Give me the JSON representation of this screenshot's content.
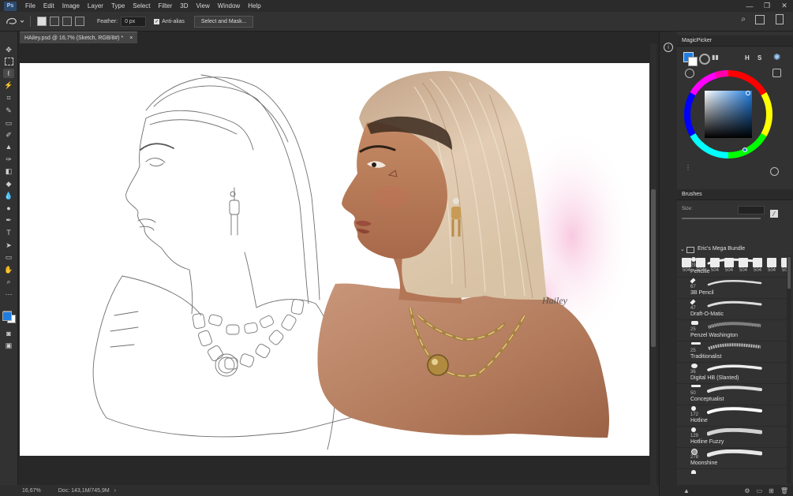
{
  "menu": [
    "File",
    "Edit",
    "Image",
    "Layer",
    "Type",
    "Select",
    "Filter",
    "3D",
    "View",
    "Window",
    "Help"
  ],
  "app_logo": "Ps",
  "options": {
    "feather_label": "Feather:",
    "feather_value": "0 px",
    "antialias_label": "Anti-alias",
    "select_mask": "Select and Mask..."
  },
  "document": {
    "tab": "HAiley.psd @ 16,7% (Sketch, RGB/8#) *",
    "close": "×"
  },
  "status": {
    "zoom": "16,67%",
    "doc": "Doc: 143,1M/745,9M"
  },
  "magic_picker": {
    "title": "MagicPicker",
    "h": "H",
    "s": "S",
    "fg_color": "#1f7de0",
    "bg_color": "#ffffff",
    "picked_color": "#5f9fe0"
  },
  "brushes_panel": {
    "title": "Brushes",
    "size_label": "Size:",
    "preset_sizes": [
      "504",
      "504",
      "504",
      "504",
      "504",
      "504",
      "504",
      "504"
    ],
    "folder": "Eric's Mega Bundle",
    "items": [
      {
        "size": "29",
        "name": "Pencille"
      },
      {
        "size": "67",
        "name": "3B Pencil"
      },
      {
        "size": "47",
        "name": "Draft-O-Matic"
      },
      {
        "size": "25",
        "name": "Penzel Washington"
      },
      {
        "size": "25",
        "name": "Traditionalist"
      },
      {
        "size": "36",
        "name": "Digital HB (Slanted)"
      },
      {
        "size": "50",
        "name": "Conceptualist"
      },
      {
        "size": "172",
        "name": "Hotline"
      },
      {
        "size": "129",
        "name": "Hotline Fuzzy"
      },
      {
        "size": "278",
        "name": "Moonshine"
      }
    ]
  },
  "artwork": {
    "signature": "Hailey"
  },
  "colors": {
    "ui_bg": "#282828",
    "panel": "#323232",
    "accent_blue": "#1f7de0"
  }
}
